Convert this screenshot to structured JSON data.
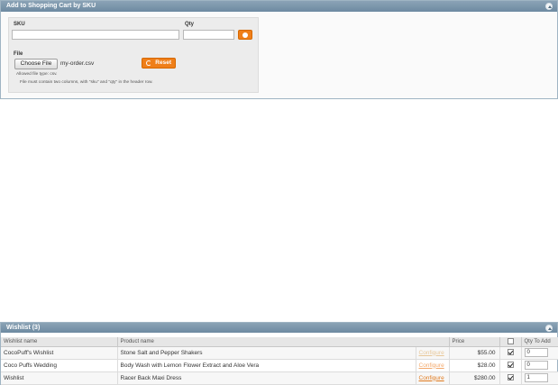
{
  "sku_panel": {
    "title": "Add to Shopping Cart by SKU",
    "collapse_icon": "chevron-up-icon",
    "sku_label": "SKU",
    "qty_label": "Qty",
    "sku_value": "",
    "qty_value": "",
    "add_icon": "add-icon",
    "file_label": "File",
    "choose_file_label": "Choose File",
    "file_name": "my-order.csv",
    "reset_label": "Reset",
    "reset_icon": "reset-icon",
    "allowed_note": "Allowed file type: csv.",
    "format_note": "File must contain two columns, with \"sku\" and \"qty\" in the header row.",
    "accent_color": "#ef7f19",
    "header_color": "#7792a8"
  },
  "wishlist": {
    "title": "Wishlist (3)",
    "collapse_icon": "chevron-up-icon",
    "columns": {
      "wishlist_name": "Wishlist name",
      "product_name": "Product name",
      "price": "Price",
      "qty_to_add": "Qty To Add"
    },
    "rows": [
      {
        "wishlist_name": "CocoPuff's Wishlist",
        "product_name": "Stone Salt and Pepper Shakers",
        "configure": "Configure",
        "configure_color": "#e8c89a",
        "price": "$55.00",
        "checked": true,
        "qty": "0"
      },
      {
        "wishlist_name": "Coco Puffs Wedding",
        "product_name": "Body Wash with Lemon Flower Extract and Aloe Vera",
        "configure": "Configure",
        "configure_color": "#f3a86a",
        "price": "$28.00",
        "checked": true,
        "qty": "0"
      },
      {
        "wishlist_name": "Wishlist",
        "product_name": "Racer Back Maxi Dress",
        "configure": "Configure",
        "configure_color": "#e07a1e",
        "price": "$280.00",
        "checked": true,
        "qty": "1"
      }
    ]
  }
}
